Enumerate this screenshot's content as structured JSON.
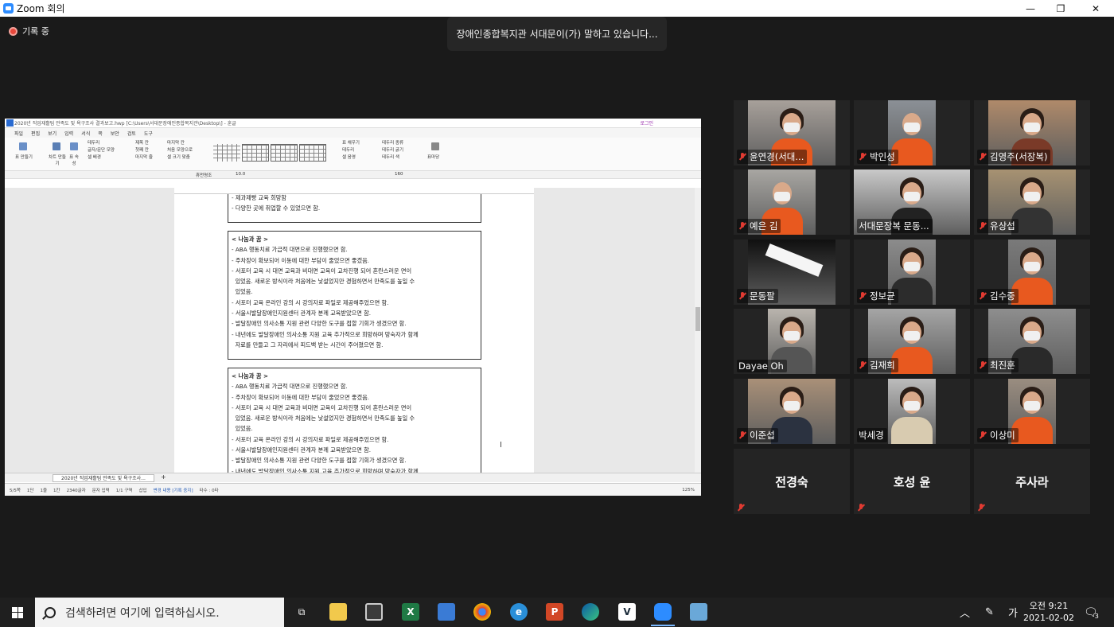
{
  "window": {
    "title": "Zoom 회의",
    "minimize": "—",
    "maximize": "❐",
    "close": "✕"
  },
  "recording": {
    "label": "기록 중"
  },
  "speaking_banner": "장애인종합복지관 서대문이(가) 말하고 있습니다...",
  "shared_screen": {
    "title_bar": "2020년 직업재활팀 만족도 및 욕구조사 결과보고.hwp [C:\\Users\\서대문장애인종합복지관\\Desktop\\] - 훈글",
    "login": "로그인",
    "menu": [
      "파일",
      "편집",
      "보기",
      "입력",
      "서식",
      "쪽",
      "보안",
      "검토",
      "도구"
    ],
    "ribbon": {
      "table_make": "표 만들기",
      "chart_make": "차트 만들기",
      "table_props": "표 속성",
      "check1": [
        "테두리",
        "글자/문단 모양",
        "셀 배경"
      ],
      "check2": [
        "제목 칸",
        "첫째 칸",
        "마지막 줄"
      ],
      "check3": [
        "마지막 칸",
        "처음 모양으로",
        "셀 크기 맞춤"
      ],
      "right1": [
        "표 채우기",
        "테두리",
        "셀 음영"
      ],
      "right2": [
        "테두리 종류",
        "테두리 굵기",
        "테두리 색"
      ],
      "presentation": "표마당"
    },
    "font_name": "휴먼명조",
    "font_size": "10.0",
    "zoom_field": "160",
    "doc_box1_lines": [
      "- 제과제빵 교육 희망함",
      "- 다양한 곳에 취업할 수 있었으면 함."
    ],
    "doc_box2_title": "< 나눔과 꿈 >",
    "doc_box2_lines": [
      "- ABA 행동치료 가급적 대면으로 진행했으면 함.",
      "- 주차장이 확보되어 이동에 대한 부담이 줄었으면 좋겠음.",
      "- 서포터 교육 시 대면 교육과 비대면 교육이 교차진행 되어 혼란스러운 면이",
      "  있었음. 새로운 방식이라 처음에는 낯설었지만 경험하면서 만족도를 높일 수",
      "  있었음.",
      "- 서포터 교육 온라인 강의 시 강의자료 파일로 제공해주었으면 함.",
      "- 서울시발달장애인지원센터 관계자 분께 교육받았으면 함.",
      "- 발달장애인 의사소통 지원 관련 다양한 도구를 접할 기회가 생겼으면 함.",
      "- 내년에도 발달장애인 의사소통 지원 교육 추가적으로 희망하며 망숙자가 함께",
      "  자료를 만들고 그 자리에서 피드백 받는 시간이 주어졌으면 함."
    ],
    "doc_box3_title": "< 나눔과 꿈 >",
    "doc_box3_lines": [
      "- ABA 행동치료 가급적 대면으로 진행했으면 함.",
      "- 주차장이 확보되어 이동에 대한 부담이 줄었으면 좋겠음.",
      "- 서포터 교육 시 대면 교육과 비대면 교육이 교차진행 되어 혼란스러운 면이",
      "  있었음. 새로운 방식이라 처음에는 낯설었지만 경험하면서 만족도를 높일 수",
      "  있었음.",
      "- 서포터 교육 온라인 강의 시 강의자료 파일로 제공해주었으면 함.",
      "- 서울시발달장애인지원센터 관계자 분께 교육받았으면 함.",
      "- 발달장애인 의사소통 지원 관련 다양한 도구를 접할 기회가 생겼으면 함.",
      "- 내년에도 발달장애인 의사소통 지원 교육 추가적으로 희망하며 망숙자가 함께"
    ],
    "doc_tab": "2020년 직업재활팀 만족도 및 욕구조사...",
    "status": [
      "5/5쪽",
      "1단",
      "1줄",
      "1칸",
      "2340글자",
      "문자 입력",
      "1/1 구역",
      "삽입",
      "변경 내용 [기록 중지]",
      "타수 : 0타",
      "125%"
    ]
  },
  "participants": [
    {
      "name": "윤연경(서대...",
      "muted": true
    },
    {
      "name": "박인성",
      "muted": true
    },
    {
      "name": "김영주(서장복)",
      "muted": true
    },
    {
      "name": "예은 김",
      "muted": true
    },
    {
      "name": "서대문장복 문동...",
      "muted": false
    },
    {
      "name": "유상섭",
      "muted": true
    },
    {
      "name": "문동팔",
      "muted": true
    },
    {
      "name": "정보균",
      "muted": true
    },
    {
      "name": "김수중",
      "muted": true
    },
    {
      "name": "Dayae Oh",
      "muted": false
    },
    {
      "name": "김재희",
      "muted": true
    },
    {
      "name": "최진훈",
      "muted": true
    },
    {
      "name": "이준섭",
      "muted": true
    },
    {
      "name": "박세경",
      "muted": false
    },
    {
      "name": "이상미",
      "muted": true
    },
    {
      "name": "전경숙",
      "muted": true
    },
    {
      "name": "호성 윤",
      "muted": true
    },
    {
      "name": "주사라",
      "muted": true
    }
  ],
  "taskbar": {
    "search_placeholder": "검색하려면 여기에 입력하십시오.",
    "ime": "가",
    "time": "오전 9:21",
    "date": "2021-02-02",
    "notifications": "3"
  },
  "colors": {
    "meeting_bg": "#1a1a1a",
    "tile_bg": "#242424",
    "mute_red": "#e03b32",
    "zoom_blue": "#2d8cff",
    "orange_vest": "#e8591f"
  }
}
